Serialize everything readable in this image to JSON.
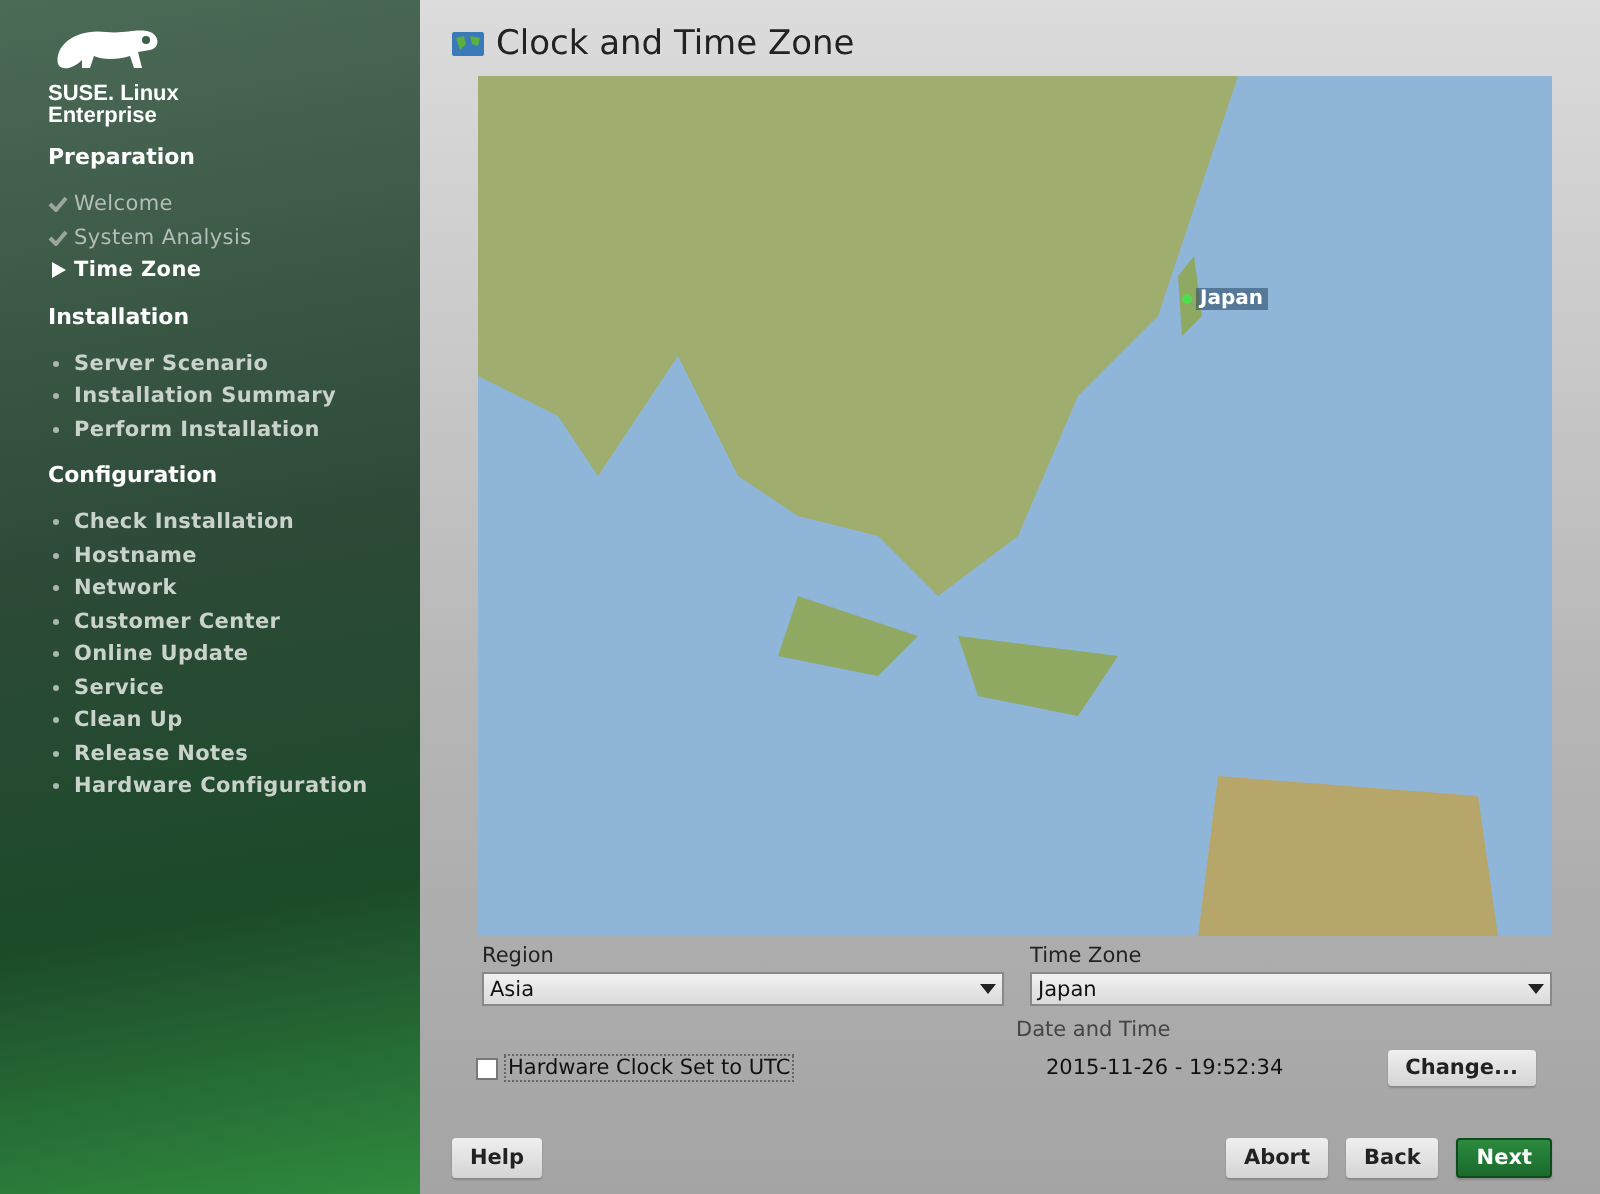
{
  "brand": {
    "line1": "SUSE. Linux",
    "line2": "Enterprise"
  },
  "sidebar": {
    "sections": [
      {
        "title": "Preparation",
        "steps": [
          {
            "label": "Welcome",
            "kind": "done"
          },
          {
            "label": "System Analysis",
            "kind": "done"
          },
          {
            "label": "Time Zone",
            "kind": "current"
          }
        ]
      },
      {
        "title": "Installation",
        "steps": [
          {
            "label": "Server Scenario",
            "kind": "pending"
          },
          {
            "label": "Installation Summary",
            "kind": "pending"
          },
          {
            "label": "Perform Installation",
            "kind": "pending"
          }
        ]
      },
      {
        "title": "Configuration",
        "steps": [
          {
            "label": "Check Installation",
            "kind": "pending"
          },
          {
            "label": "Hostname",
            "kind": "pending"
          },
          {
            "label": "Network",
            "kind": "pending"
          },
          {
            "label": "Customer Center",
            "kind": "pending"
          },
          {
            "label": "Online Update",
            "kind": "pending"
          },
          {
            "label": "Service",
            "kind": "pending"
          },
          {
            "label": "Clean Up",
            "kind": "pending"
          },
          {
            "label": "Release Notes",
            "kind": "pending"
          },
          {
            "label": "Hardware Configuration",
            "kind": "pending"
          }
        ]
      }
    ]
  },
  "window": {
    "title": "Clock and Time Zone"
  },
  "map": {
    "marker_label": "Japan"
  },
  "region": {
    "label": "Region",
    "value": "Asia"
  },
  "time_zone": {
    "label": "Time Zone",
    "value": "Japan"
  },
  "date_time": {
    "label": "Date and Time",
    "value": "2015-11-26 - 19:52:34"
  },
  "hardware_clock": {
    "label": "Hardware Clock Set to UTC",
    "checked": false
  },
  "change_button": {
    "label": "Change..."
  },
  "buttons": [
    {
      "label": "Help",
      "kind": "plain"
    },
    {
      "label": "Abort",
      "kind": "plain"
    },
    {
      "label": "Back",
      "kind": "plain"
    },
    {
      "label": "Next",
      "kind": "primary"
    }
  ]
}
